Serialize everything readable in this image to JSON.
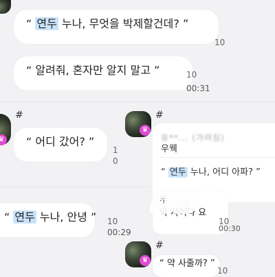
{
  "messages": [
    {
      "id": "m1",
      "prefix": "“ ",
      "highlight": "연두",
      "text": " 누나, 무엇을 박제할건데? ”",
      "count": "10",
      "time": ""
    },
    {
      "id": "m2",
      "prefix": "“ 알려줘, 혼자만 알지 말고 ”",
      "highlight": "",
      "text": "",
      "count": "10",
      "time": "00:31"
    },
    {
      "id": "m3",
      "prefix": "“ 어디 갔어? ”",
      "highlight": "",
      "text": "",
      "count": "1",
      "count2": "0",
      "time": ""
    },
    {
      "id": "m4",
      "prefix": "“ ",
      "highlight": "연두",
      "text": " 누나, 안녕 ”",
      "count": "10",
      "time": "00:29"
    }
  ],
  "hash_symbol": "#",
  "reply": {
    "sender_blurred": "유**... (가려짐)",
    "title": "우웩",
    "quote_prefix": "“ ",
    "quote_highlight": "연두",
    "quote_text": " 누나, 어디 아파? ”",
    "partial_line1": "무",
    "partial_line2": "약 사어다 요",
    "count": "10",
    "time": "00:30"
  },
  "right_bottom": {
    "text": "“ 약 사줄까? ”",
    "count": "10"
  },
  "colors": {
    "background": "#f2f2f4",
    "bubble": "#ffffff",
    "highlight": "#c9e3fb",
    "crown_badge": "#e14bd3"
  },
  "icons": [
    "crown-icon"
  ]
}
